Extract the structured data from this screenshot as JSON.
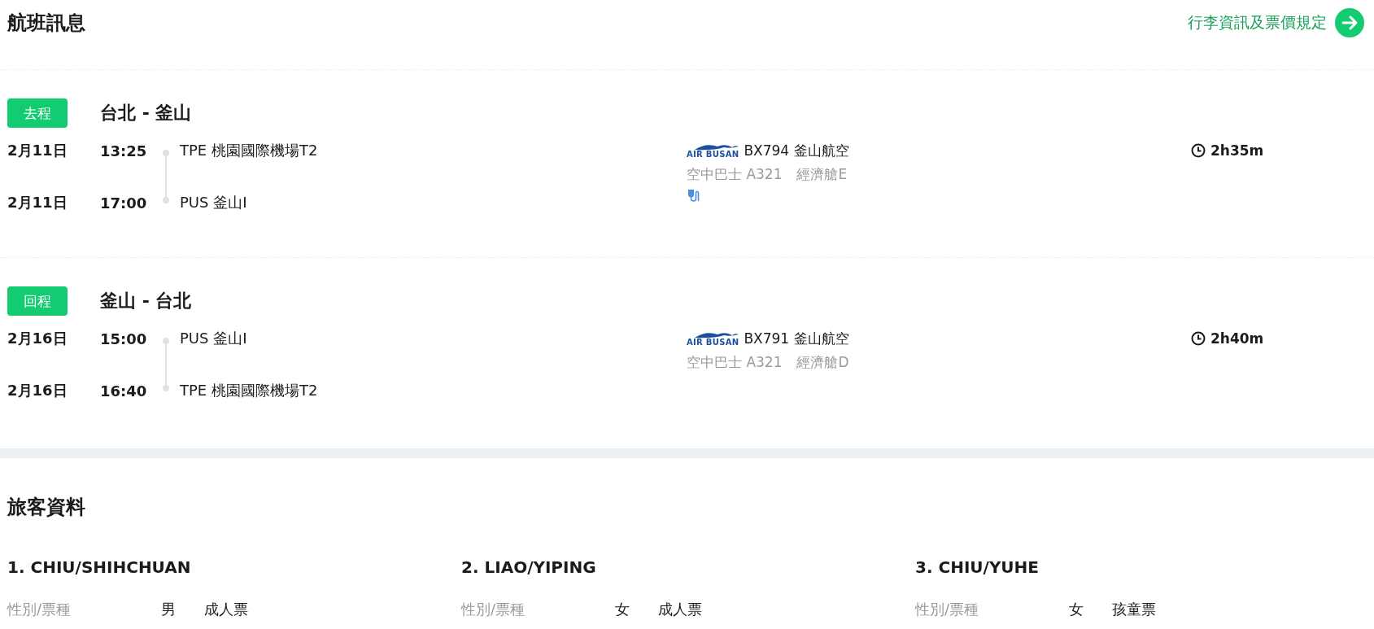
{
  "section_title": "航班訊息",
  "baggage_link": "行李資訊及票價規定",
  "legs": [
    {
      "badge": "去程",
      "route": "台北 - 釜山",
      "segments": [
        {
          "date": "2月11日",
          "time": "13:25",
          "airport": "TPE 桃園國際機場T2"
        },
        {
          "date": "2月11日",
          "time": "17:00",
          "airport": "PUS 釜山I"
        }
      ],
      "airline_logo": "AIR BUSAN",
      "flight": "BX794 釜山航空",
      "aircraft": "空中巴士 A321",
      "cabin": "經濟艙E",
      "power_outlet": true,
      "duration": "2h35m"
    },
    {
      "badge": "回程",
      "route": "釜山 - 台北",
      "segments": [
        {
          "date": "2月16日",
          "time": "15:00",
          "airport": "PUS 釜山I"
        },
        {
          "date": "2月16日",
          "time": "16:40",
          "airport": "TPE 桃園國際機場T2"
        }
      ],
      "airline_logo": "AIR BUSAN",
      "flight": "BX791 釜山航空",
      "aircraft": "空中巴士 A321",
      "cabin": "經濟艙D",
      "power_outlet": false,
      "duration": "2h40m"
    }
  ],
  "passengers_title": "旅客資料",
  "passengers": [
    {
      "name": "1. CHIU/SHIHCHUAN",
      "label": "性別/票種",
      "gender": "男",
      "ticket": "成人票"
    },
    {
      "name": "2. LIAO/YIPING",
      "label": "性別/票種",
      "gender": "女",
      "ticket": "成人票"
    },
    {
      "name": "3. CHIU/YUHE",
      "label": "性別/票種",
      "gender": "女",
      "ticket": "孩童票"
    }
  ]
}
